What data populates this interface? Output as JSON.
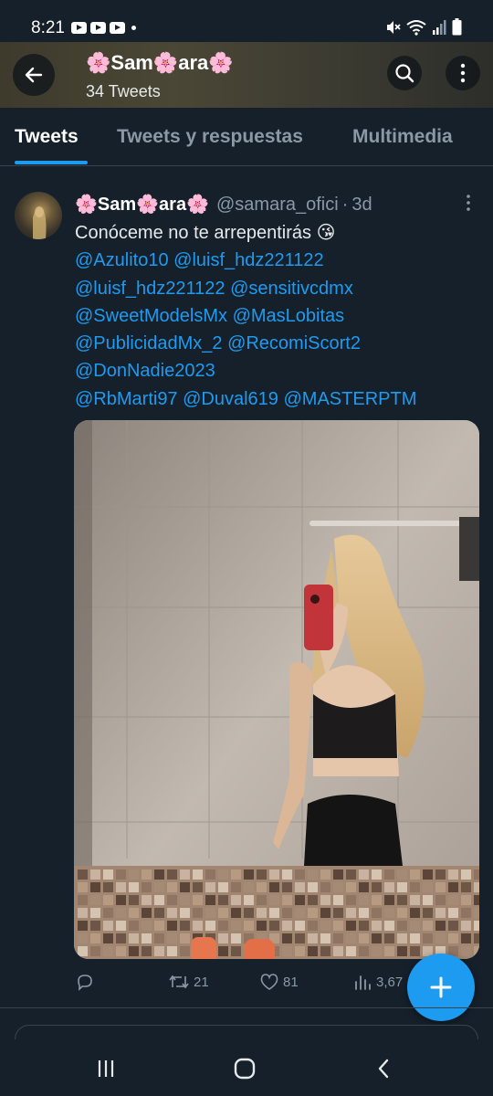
{
  "status_bar": {
    "time": "8:21",
    "notification_icons": [
      "youtube-icon",
      "youtube-icon",
      "youtube-icon",
      "dot-icon"
    ],
    "right_icons": [
      "mute-icon",
      "wifi-icon",
      "signal-icon",
      "battery-icon"
    ]
  },
  "header": {
    "back_icon": "arrow-left-icon",
    "profile_name": "🌸Sam🌸ara🌸",
    "tweet_count": "34 Tweets",
    "search_icon": "search-icon",
    "more_icon": "more-vertical-icon",
    "banner_color": "#4b4736"
  },
  "tabs": [
    {
      "label": "Tweets",
      "active": true
    },
    {
      "label": "Tweets y respuestas",
      "active": false
    },
    {
      "label": "Multimedia",
      "active": false
    }
  ],
  "tweet": {
    "author_name": "🌸Sam🌸ara🌸",
    "handle": "@samara_ofici",
    "separator": "·",
    "time": "3d",
    "lines": [
      [
        {
          "text": "Conóceme no te arrepentirás 😘",
          "type": "text"
        }
      ],
      [
        {
          "text": "@Azulito10",
          "type": "mention"
        },
        {
          "text": " ",
          "type": "text"
        },
        {
          "text": "@luisf_hdz221122",
          "type": "mention"
        }
      ],
      [
        {
          "text": "@luisf_hdz221122",
          "type": "mention"
        },
        {
          "text": " ",
          "type": "text"
        },
        {
          "text": "@sensitivcdmx",
          "type": "mention"
        }
      ],
      [
        {
          "text": "@SweetModelsMx",
          "type": "mention"
        },
        {
          "text": " ",
          "type": "text"
        },
        {
          "text": "@MasLobitas",
          "type": "mention"
        }
      ],
      [
        {
          "text": "@PublicidadMx_2",
          "type": "mention"
        },
        {
          "text": " ",
          "type": "text"
        },
        {
          "text": "@RecomiScort2",
          "type": "mention"
        }
      ],
      [
        {
          "text": "@DonNadie2023",
          "type": "mention"
        }
      ],
      [
        {
          "text": "@RbMarti97",
          "type": "mention"
        },
        {
          "text": " ",
          "type": "text"
        },
        {
          "text": "@Duval619",
          "type": "mention"
        },
        {
          "text": " ",
          "type": "text"
        },
        {
          "text": "@MASTERPTM",
          "type": "mention"
        }
      ]
    ],
    "actions": {
      "reply_count": "",
      "retweet_count": "21",
      "like_count": "81",
      "views_count": "3,67"
    }
  },
  "fab": {
    "icon": "plus-icon"
  },
  "nav_bar": {
    "icons": [
      "recent-apps-icon",
      "home-icon",
      "back-icon"
    ]
  },
  "colors": {
    "background": "#15202b",
    "accent": "#1d9bf0",
    "muted": "#8b98a5",
    "divider": "#38444d"
  }
}
